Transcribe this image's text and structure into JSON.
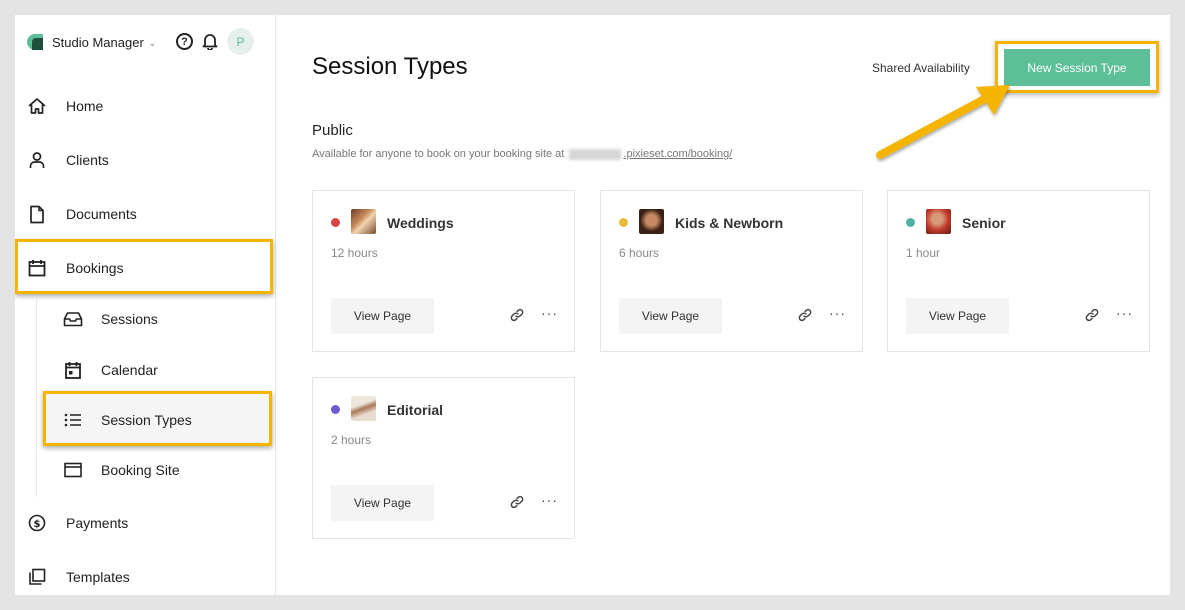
{
  "app": {
    "name": "Studio Manager",
    "avatar_initial": "P"
  },
  "colors": {
    "accent": "#5cbf98",
    "highlight": "#f4b400"
  },
  "nav": {
    "home": "Home",
    "clients": "Clients",
    "documents": "Documents",
    "bookings": "Bookings",
    "sessions": "Sessions",
    "calendar": "Calendar",
    "session_types": "Session Types",
    "booking_site": "Booking Site",
    "payments": "Payments",
    "templates": "Templates"
  },
  "main": {
    "title": "Session Types",
    "shared_availability": "Shared Availability",
    "new_button": "New Session Type",
    "section_title": "Public",
    "section_desc": "Available for anyone to book on your booking site at",
    "domain": ".pixieset.com/booking/"
  },
  "cards": [
    {
      "name": "Weddings",
      "duration": "12 hours",
      "dot_color": "#d94545",
      "view_label": "View Page"
    },
    {
      "name": "Kids & Newborn",
      "duration": "6 hours",
      "dot_color": "#e8b93c",
      "view_label": "View Page"
    },
    {
      "name": "Senior",
      "duration": "1 hour",
      "dot_color": "#4fb0a4",
      "view_label": "View Page"
    },
    {
      "name": "Editorial",
      "duration": "2 hours",
      "dot_color": "#6a5acd",
      "view_label": "View Page"
    }
  ]
}
